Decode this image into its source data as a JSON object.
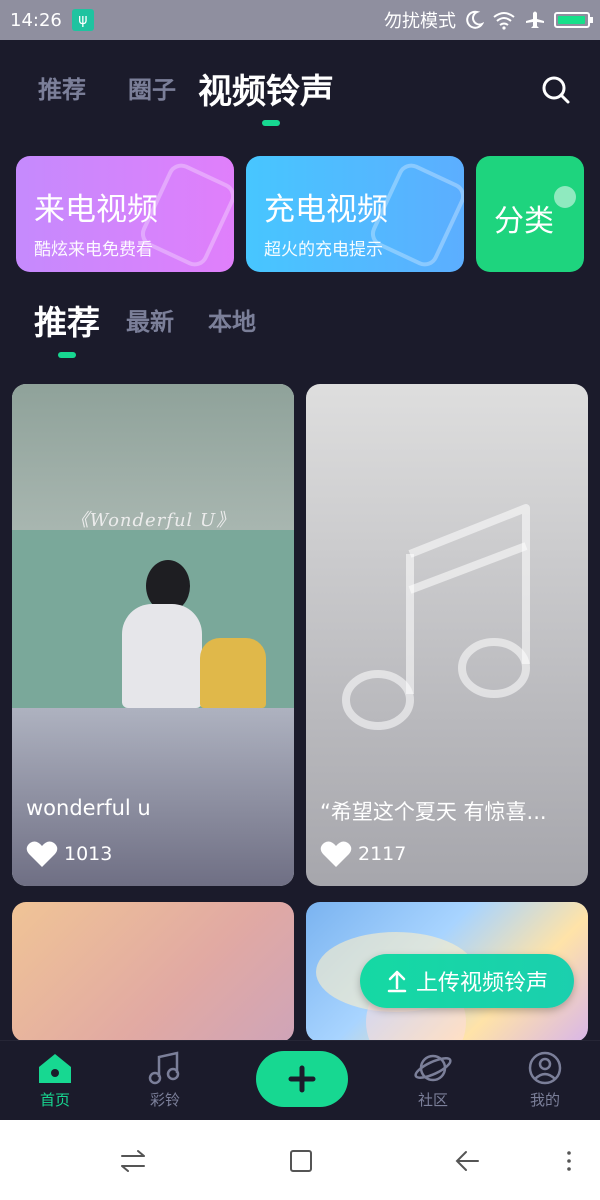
{
  "status_bar": {
    "time": "14:26",
    "dnd_text": "勿扰模式",
    "battery_percent": 95
  },
  "header": {
    "tabs": [
      {
        "label": "推荐"
      },
      {
        "label": "圈子"
      },
      {
        "label": "视频铃声",
        "active": true
      }
    ]
  },
  "features": [
    {
      "title": "来电视频",
      "subtitle": "酷炫来电免费看"
    },
    {
      "title": "充电视频",
      "subtitle": "超火的充电提示"
    },
    {
      "title": "分类",
      "subtitle": ""
    }
  ],
  "subtabs": [
    {
      "label": "推荐",
      "active": true
    },
    {
      "label": "最新"
    },
    {
      "label": "本地"
    }
  ],
  "cards": [
    {
      "title": "wonderful u",
      "likes": "1013",
      "artwork_text": "《Wonderful U》"
    },
    {
      "title": "“希望这个夏天 有惊喜...",
      "likes": "2117"
    }
  ],
  "upload_button": {
    "label": "上传视频铃声"
  },
  "bottom_nav": [
    {
      "label": "首页",
      "active": true
    },
    {
      "label": "彩铃"
    },
    {
      "label": "社区"
    },
    {
      "label": "我的"
    }
  ],
  "colors": {
    "accent": "#17d891",
    "background": "#1b1b2b",
    "purple_card": "#d884fc",
    "blue_card": "#4fbaff",
    "green_card": "#1ed47e"
  }
}
